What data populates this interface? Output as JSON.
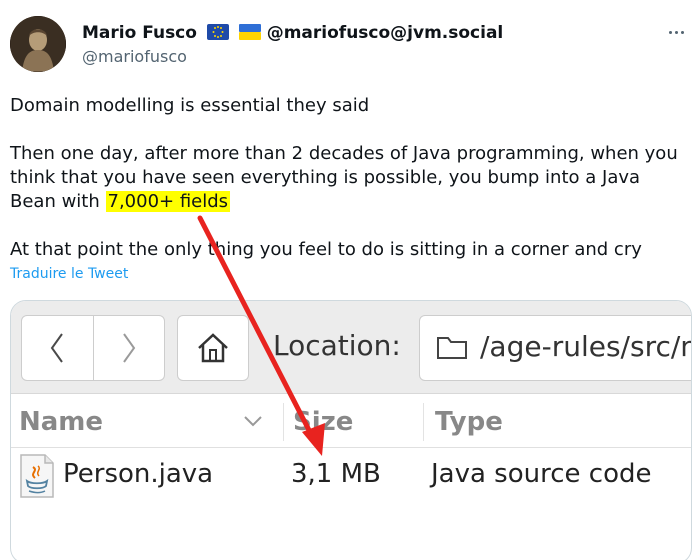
{
  "author": {
    "display_name": "Mario Fusco",
    "flags": [
      "eu-flag",
      "ukraine-flag"
    ],
    "fediverse": "@mariofusco@jvm.social",
    "handle": "@mariofusco"
  },
  "tweet": {
    "line1": "Domain modelling is essential they said",
    "line2_before": "Then one day, after more than 2 decades of Java programming, when you think that you have seen everything is possible, you bump into a Java Bean with ",
    "line2_highlight": "7,000+ fields",
    "line3": "At that point the only thing you feel to do is sitting in a corner and cry",
    "translate_label": "Traduire le Tweet",
    "highlight_color": "#ffff00",
    "annotation_arrow_color": "#e8231f"
  },
  "file_manager": {
    "back_icon": "chevron-left-icon",
    "forward_icon": "chevron-right-icon",
    "home_icon": "home-icon",
    "location_label": "Location:",
    "location_path": "/age-rules/src/m",
    "columns": {
      "name": "Name",
      "size": "Size",
      "type": "Type"
    },
    "files": [
      {
        "name": "Person.java",
        "size": "3,1 MB",
        "type": "Java source code",
        "icon": "java-file-icon"
      }
    ]
  }
}
